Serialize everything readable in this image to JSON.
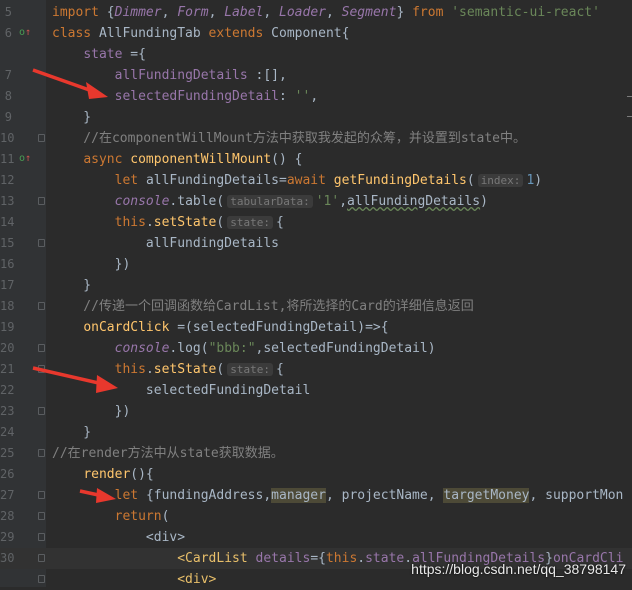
{
  "editor": {
    "lines": [
      {
        "num": "5",
        "tokens": [
          {
            "t": "import ",
            "c": "kw"
          },
          {
            "t": "{",
            "c": ""
          },
          {
            "t": "Dimmer",
            "c": "fld it"
          },
          {
            "t": ", ",
            "c": ""
          },
          {
            "t": "Form",
            "c": "fld it"
          },
          {
            "t": ", ",
            "c": ""
          },
          {
            "t": "Label",
            "c": "fld it"
          },
          {
            "t": ", ",
            "c": ""
          },
          {
            "t": "Loader",
            "c": "fld it"
          },
          {
            "t": ", ",
            "c": ""
          },
          {
            "t": "Segment",
            "c": "fld it"
          },
          {
            "t": "} ",
            "c": ""
          },
          {
            "t": "from ",
            "c": "kw"
          },
          {
            "t": "'semantic-ui-react'",
            "c": "str"
          }
        ]
      },
      {
        "num": "6",
        "tokens": [
          {
            "t": "class ",
            "c": "kw"
          },
          {
            "t": "AllFundingTab ",
            "c": ""
          },
          {
            "t": "extends ",
            "c": "kw"
          },
          {
            "t": "Component{",
            "c": ""
          }
        ]
      },
      {
        "num": "",
        "tokens": [
          {
            "t": "    ",
            "c": ""
          },
          {
            "t": "state ",
            "c": "fld"
          },
          {
            "t": "={",
            "c": ""
          }
        ]
      },
      {
        "num": "7",
        "tokens": [
          {
            "t": "        ",
            "c": ""
          },
          {
            "t": "allFundingDetails ",
            "c": "fld"
          },
          {
            "t": ":[],",
            "c": ""
          }
        ]
      },
      {
        "num": "8",
        "tokens": [
          {
            "t": "        ",
            "c": ""
          },
          {
            "t": "selectedFundingDetail",
            "c": "fld"
          },
          {
            "t": ": ",
            "c": ""
          },
          {
            "t": "''",
            "c": "str"
          },
          {
            "t": ",",
            "c": ""
          }
        ]
      },
      {
        "num": "9",
        "tokens": [
          {
            "t": "    }",
            "c": ""
          }
        ]
      },
      {
        "num": "10",
        "tokens": [
          {
            "t": "    //在componentWillMount方法中获取我发起的众筹，并设置到state中。",
            "c": "cm"
          }
        ]
      },
      {
        "num": "11",
        "tokens": [
          {
            "t": "    ",
            "c": ""
          },
          {
            "t": "async ",
            "c": "kw"
          },
          {
            "t": "componentWillMount",
            "c": "fn"
          },
          {
            "t": "() {",
            "c": ""
          }
        ]
      },
      {
        "num": "12",
        "tokens": [
          {
            "t": "        ",
            "c": ""
          },
          {
            "t": "let ",
            "c": "kw"
          },
          {
            "t": "allFundingDetails=",
            "c": ""
          },
          {
            "t": "await ",
            "c": "kw"
          },
          {
            "t": "getFundingDetails",
            "c": "fn"
          },
          {
            "t": "(",
            "c": ""
          },
          {
            "t": "index:",
            "c": "hint"
          },
          {
            "t": "1",
            "c": "num"
          },
          {
            "t": ")",
            "c": ""
          }
        ]
      },
      {
        "num": "13",
        "tokens": [
          {
            "t": "        ",
            "c": ""
          },
          {
            "t": "console",
            "c": "fld it"
          },
          {
            "t": ".",
            "c": ""
          },
          {
            "t": "table",
            "c": ""
          },
          {
            "t": "(",
            "c": ""
          },
          {
            "t": "tabularData:",
            "c": "hint"
          },
          {
            "t": "'1'",
            "c": "str"
          },
          {
            "t": ",",
            "c": ""
          },
          {
            "t": "allFundingDetails",
            "c": "wavy"
          },
          {
            "t": ")",
            "c": ""
          }
        ]
      },
      {
        "num": "14",
        "tokens": [
          {
            "t": "        ",
            "c": ""
          },
          {
            "t": "this",
            "c": "kw"
          },
          {
            "t": ".",
            "c": ""
          },
          {
            "t": "setState",
            "c": "fn"
          },
          {
            "t": "(",
            "c": ""
          },
          {
            "t": "state:",
            "c": "hint"
          },
          {
            "t": "{",
            "c": ""
          }
        ]
      },
      {
        "num": "15",
        "tokens": [
          {
            "t": "            allFundingDetails",
            "c": ""
          }
        ]
      },
      {
        "num": "16",
        "tokens": [
          {
            "t": "        })",
            "c": ""
          }
        ]
      },
      {
        "num": "17",
        "tokens": [
          {
            "t": "    }",
            "c": ""
          }
        ]
      },
      {
        "num": "18",
        "tokens": [
          {
            "t": "    //传递一个回调函数给CardList,将所选择的Card的详细信息返回",
            "c": "cm"
          }
        ]
      },
      {
        "num": "19",
        "tokens": [
          {
            "t": "    ",
            "c": ""
          },
          {
            "t": "onCardClick ",
            "c": "fn"
          },
          {
            "t": "=(selectedFundingDetail)=>{",
            "c": ""
          }
        ]
      },
      {
        "num": "20",
        "tokens": [
          {
            "t": "        ",
            "c": ""
          },
          {
            "t": "console",
            "c": "fld it"
          },
          {
            "t": ".",
            "c": ""
          },
          {
            "t": "log",
            "c": ""
          },
          {
            "t": "(",
            "c": ""
          },
          {
            "t": "\"bbb:\"",
            "c": "str"
          },
          {
            "t": ",selectedFundingDetail)",
            "c": ""
          }
        ]
      },
      {
        "num": "21",
        "tokens": [
          {
            "t": "        ",
            "c": ""
          },
          {
            "t": "this",
            "c": "kw"
          },
          {
            "t": ".",
            "c": ""
          },
          {
            "t": "setState",
            "c": "fn"
          },
          {
            "t": "(",
            "c": ""
          },
          {
            "t": "state:",
            "c": "hint"
          },
          {
            "t": "{",
            "c": ""
          }
        ]
      },
      {
        "num": "22",
        "tokens": [
          {
            "t": "            selectedFundingDetail",
            "c": ""
          }
        ]
      },
      {
        "num": "23",
        "tokens": [
          {
            "t": "        })",
            "c": ""
          }
        ]
      },
      {
        "num": "24",
        "tokens": [
          {
            "t": "    }",
            "c": ""
          }
        ]
      },
      {
        "num": "25",
        "tokens": [
          {
            "t": "//在render方法中从state获取数据。",
            "c": "cm"
          }
        ]
      },
      {
        "num": "26",
        "tokens": [
          {
            "t": "    ",
            "c": ""
          },
          {
            "t": "render",
            "c": "fn"
          },
          {
            "t": "(){",
            "c": ""
          }
        ]
      },
      {
        "num": "27",
        "tokens": [
          {
            "t": "        ",
            "c": ""
          },
          {
            "t": "let ",
            "c": "kw"
          },
          {
            "t": "{fundingAddress,",
            "c": ""
          },
          {
            "t": "manager",
            "c": "unused"
          },
          {
            "t": ", projectName, ",
            "c": ""
          },
          {
            "t": "targetMoney",
            "c": "unused"
          },
          {
            "t": ", supportMon",
            "c": ""
          }
        ]
      },
      {
        "num": "28",
        "tokens": [
          {
            "t": "        ",
            "c": ""
          },
          {
            "t": "return",
            "c": "kw"
          },
          {
            "t": "(",
            "c": ""
          }
        ]
      },
      {
        "num": "29",
        "tokens": [
          {
            "t": "            <div>",
            "c": "gray"
          }
        ]
      },
      {
        "num": "30",
        "tokens": [
          {
            "t": "                ",
            "c": ""
          },
          {
            "t": "<CardList ",
            "c": "tag"
          },
          {
            "t": "details",
            "c": "fld"
          },
          {
            "t": "={",
            "c": ""
          },
          {
            "t": "this",
            "c": "kw"
          },
          {
            "t": ".",
            "c": ""
          },
          {
            "t": "state",
            "c": "fld"
          },
          {
            "t": ".",
            "c": ""
          },
          {
            "t": "allFundingDetails",
            "c": "fld"
          },
          {
            "t": "}",
            "c": ""
          },
          {
            "t": "onCardCli",
            "c": "fld"
          }
        ]
      },
      {
        "num": "",
        "tokens": [
          {
            "t": "                ",
            "c": ""
          },
          {
            "t": "<div>",
            "c": "tag"
          }
        ]
      }
    ],
    "override_marks": {
      "6": "o↑",
      "11": "o↑"
    }
  },
  "annotation": {
    "arrow_color": "#e8382d"
  },
  "watermark": "https://blog.csdn.net/qq_38798147"
}
